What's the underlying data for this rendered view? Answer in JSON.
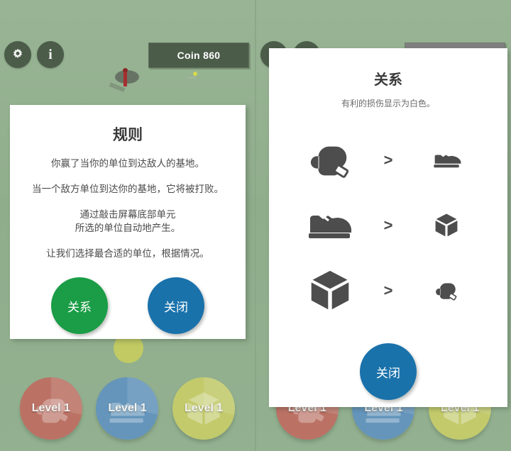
{
  "app": {
    "background_color": "#93b08f",
    "panels": [
      "left",
      "right"
    ]
  },
  "hud": {
    "settings_icon": "gear-icon",
    "info_icon": "info-icon",
    "coin_label": "Coin 860",
    "coin_color_left": "#4b5c49",
    "coin_color_right": "#808080"
  },
  "rules_dialog": {
    "title": "规则",
    "lines": [
      "你赢了当你的单位到达敌人的基地。",
      "当一个敌方单位到达你的基地，它将被打败。",
      "通过敲击屏幕底部单元",
      "所选的单位自动地产生。",
      "让我们选择最合适的单位，根据情况。"
    ],
    "relations_button": "关系",
    "close_button": "关闭",
    "relations_button_color": "#1a9d46",
    "close_button_color": "#1a72ab"
  },
  "relations_dialog": {
    "title": "关系",
    "subtitle": "有利的损伤显示为白色。",
    "rows": [
      {
        "left_icon": "boxing-glove-icon",
        "operator": ">",
        "right_icon": "shoe-icon"
      },
      {
        "left_icon": "shoe-icon",
        "operator": ">",
        "right_icon": "cube-icon"
      },
      {
        "left_icon": "cube-icon",
        "operator": ">",
        "right_icon": "boxing-glove-icon"
      }
    ],
    "close_button": "关闭",
    "close_button_color": "#1a72ab"
  },
  "unit_bar": {
    "units": [
      {
        "name": "glove-unit",
        "label": "Level 1",
        "color": "#c5645c",
        "icon": "boxing-glove-icon"
      },
      {
        "name": "shoe-unit",
        "label": "Level 1",
        "color": "#5b8fc4",
        "icon": "shoe-icon"
      },
      {
        "name": "cube-unit",
        "label": "Level 1",
        "color": "#cdcf63",
        "icon": "cube-icon"
      }
    ]
  }
}
